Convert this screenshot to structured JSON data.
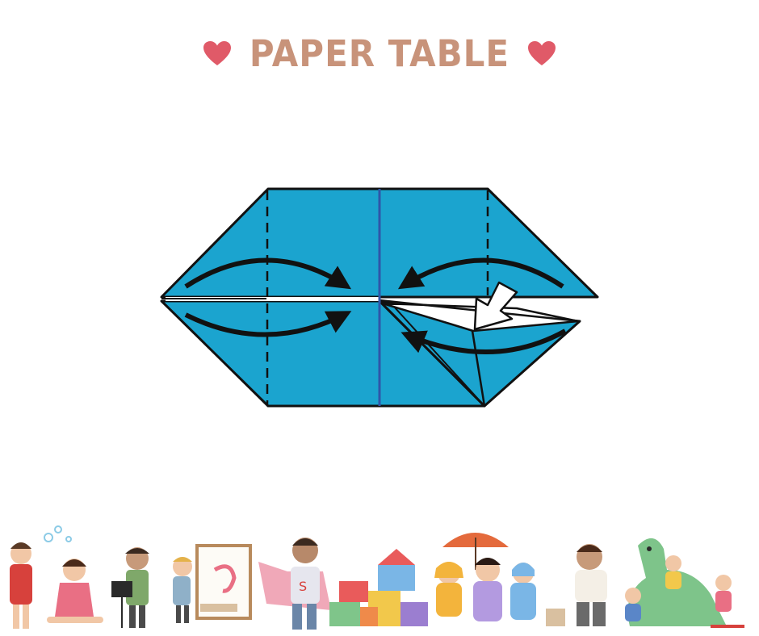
{
  "header": {
    "title": "PAPER TABLE",
    "left_icon": "heart-icon",
    "right_icon": "heart-icon",
    "heart_color": "#e05a68",
    "title_color": "#c8937a"
  },
  "diagram": {
    "paper_color": "#1ba4cf",
    "outline_color": "#111111",
    "center_line_color": "#2f56a8",
    "arrow_color": "#111111"
  },
  "footer": {
    "illustration": "watercolor-children-playing-strip"
  }
}
